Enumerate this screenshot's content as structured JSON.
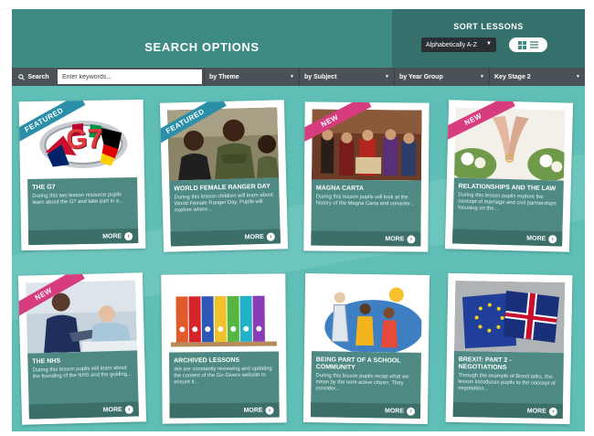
{
  "header": {
    "title": "SEARCH OPTIONS",
    "sort_title": "SORT LESSONS",
    "sort_value": "Alphabetically A-Z"
  },
  "search": {
    "label": "Search",
    "placeholder": "Enter keywords..."
  },
  "filters": [
    {
      "label": "by Theme"
    },
    {
      "label": "by Subject"
    },
    {
      "label": "by Year Group"
    },
    {
      "label": "Key Stage 2"
    }
  ],
  "more_label": "MORE",
  "cards": [
    {
      "ribbon": "FEATURED",
      "title": "THE G7",
      "desc": "During this two lesson resource pupils learn about the G7 and take part in a..."
    },
    {
      "ribbon": "FEATURED",
      "title": "WORLD FEMALE RANGER DAY",
      "desc": "During this lesson children will learn about World Female Ranger Day. Pupils will explore where..."
    },
    {
      "ribbon": "NEW",
      "title": "MAGNA CARTA",
      "desc": "During this lesson pupils will look at the history of the Magna Carta and consider..."
    },
    {
      "ribbon": "NEW",
      "title": "RELATIONSHIPS AND THE LAW",
      "desc": "During this lesson pupils explore the concept of marriage and civil partnerships focusing on the..."
    },
    {
      "ribbon": "NEW",
      "title": "THE NHS",
      "desc": "During this lesson pupils will learn about the founding of the NHS and the guiding..."
    },
    {
      "ribbon": "",
      "title": "ARCHIVED LESSONS",
      "desc": "We are constantly reviewing and updating the content of the Go-Givers website to ensure it..."
    },
    {
      "ribbon": "",
      "title": "BEING PART OF A SCHOOL COMMUNITY",
      "desc": "During this lesson pupils recap what we mean by the term active citizen. They consider..."
    },
    {
      "ribbon": "",
      "title": "BREXIT: PART 2 - NEGOTIATIONS",
      "desc": "Through the example of Brexit talks, this lesson introduces pupils to the concept of negotiation..."
    }
  ],
  "g7_logo_text": "G7",
  "colors": {
    "background": "#5fbfb6",
    "header": "#3e8b84",
    "card_info": "#4e8a83",
    "featured_ribbon": "#2a8fa7",
    "new_ribbon": "#d63c7e"
  }
}
